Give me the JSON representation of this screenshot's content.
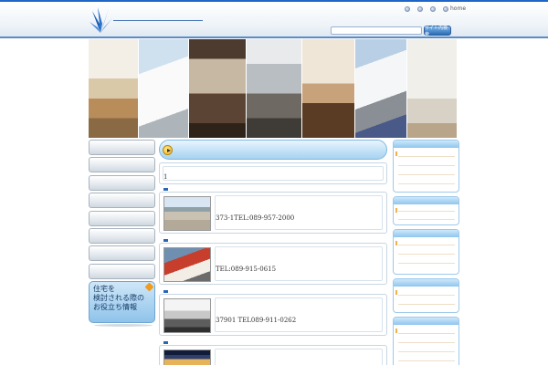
{
  "header": {
    "top_links": [
      {
        "label": ""
      },
      {
        "label": ""
      },
      {
        "label": ""
      },
      {
        "label": "home"
      }
    ],
    "search": {
      "placeholder": "",
      "button_label": "サイト内検索"
    }
  },
  "banner": {
    "photos": [
      "living-room-photo",
      "house-exterior-photo",
      "dining-table-photo",
      "courtyard-photo",
      "dining-room-photo",
      "carport-photo",
      "interior-window-photo"
    ]
  },
  "left_nav": {
    "items": [
      "",
      "",
      "",
      "",
      "",
      "",
      "",
      ""
    ],
    "promo_label": "住宅を\n検討される際の\nお役立ち情報"
  },
  "main": {
    "title": "",
    "counter": "1",
    "listings": [
      {
        "text": "373-1TEL:089-957-2000",
        "thumb": "rural-lot-photo"
      },
      {
        "text": "TEL:089-915-0615",
        "thumb": "red-house-photo"
      },
      {
        "text": "37901 TEL089-911-0262",
        "thumb": "gray-house-photo"
      },
      {
        "text": "",
        "thumb": "night-house-photo"
      }
    ]
  },
  "colors": {
    "accent_blue": "#1e66c8",
    "title_bar": "#bfe0f6",
    "play_icon": "#f2b81c",
    "promo_bg": "#8fc3ea"
  }
}
